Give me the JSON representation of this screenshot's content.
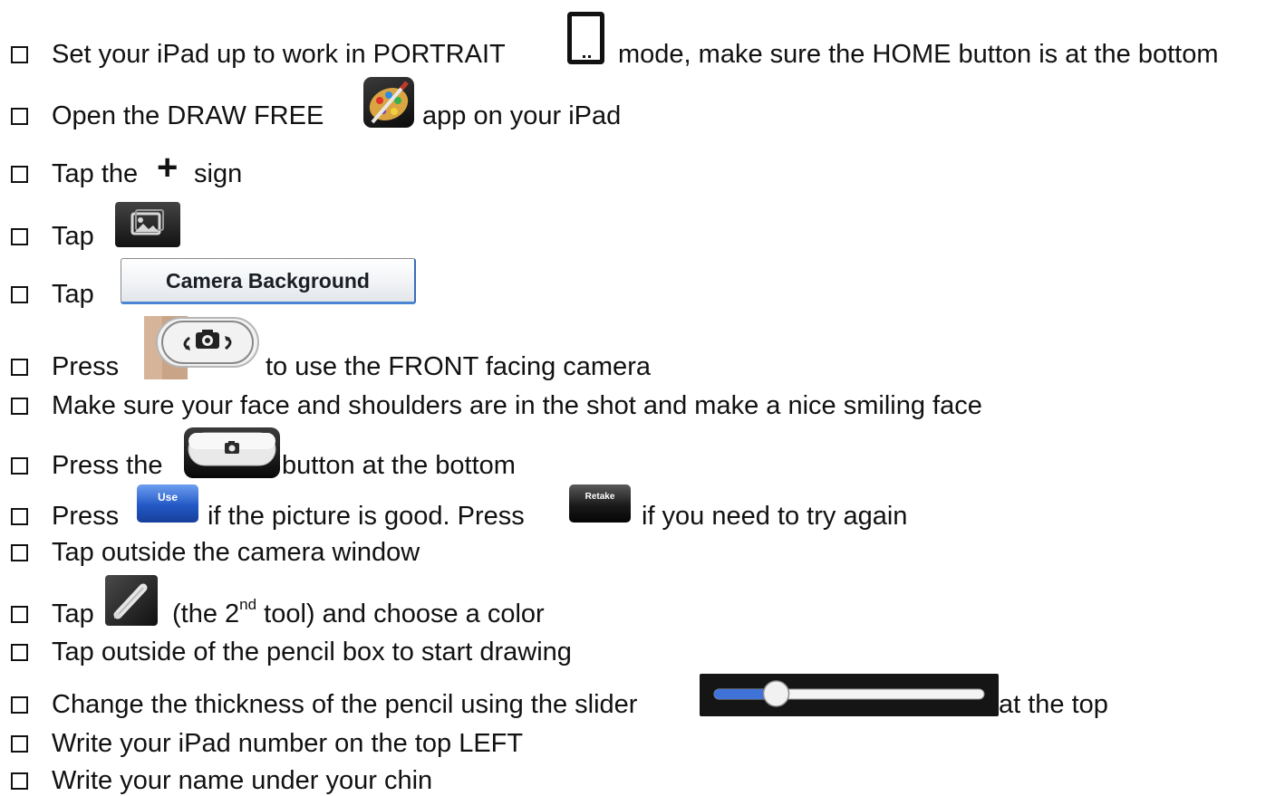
{
  "steps": [
    {
      "before": "Set your iPad up to work in PORTRAIT",
      "after": "mode, make sure the HOME button is at the bottom"
    },
    {
      "before": "Open the DRAW FREE",
      "after": "app  on your iPad"
    },
    {
      "before": "Tap the",
      "symbol": "+",
      "after": "sign"
    },
    {
      "before": "Tap"
    },
    {
      "before": "Tap",
      "button_label": "Camera Background"
    },
    {
      "before": "Press",
      "after": "to use the FRONT facing camera"
    },
    {
      "text": "Make sure your face and shoulders are in the shot and make a nice smiling face"
    },
    {
      "before": "Press the",
      "after": "button at the bottom"
    },
    {
      "before": "Press",
      "use_label": "Use",
      "middle": "if the picture is good. Press",
      "retake_label": "Retake",
      "after": "if you need to try again"
    },
    {
      "text": "Tap outside the camera window"
    },
    {
      "before": "Tap",
      "paren_open": "(the 2",
      "sup": "nd",
      "after": " tool) and choose a color"
    },
    {
      "text": "Tap outside of the pencil box to start drawing"
    },
    {
      "before": "Change the thickness of the pencil using the slider",
      "after": "at the top",
      "slider_level": 0.23
    },
    {
      "text": "Write your iPad number on the top LEFT"
    },
    {
      "text": "Write your name under your chin"
    }
  ],
  "icons": {
    "portrait": "ipad-portrait-icon",
    "draw_free": "paint-palette-icon",
    "photo": "photo-frame-icon",
    "flip_camera": "camera-flip-icon",
    "shutter": "camera-shutter-icon",
    "pencil": "pencil-icon"
  },
  "colors": {
    "use_button": "#2359c6",
    "slider_fill": "#3f73d8",
    "button_border": "#4a86d4"
  }
}
